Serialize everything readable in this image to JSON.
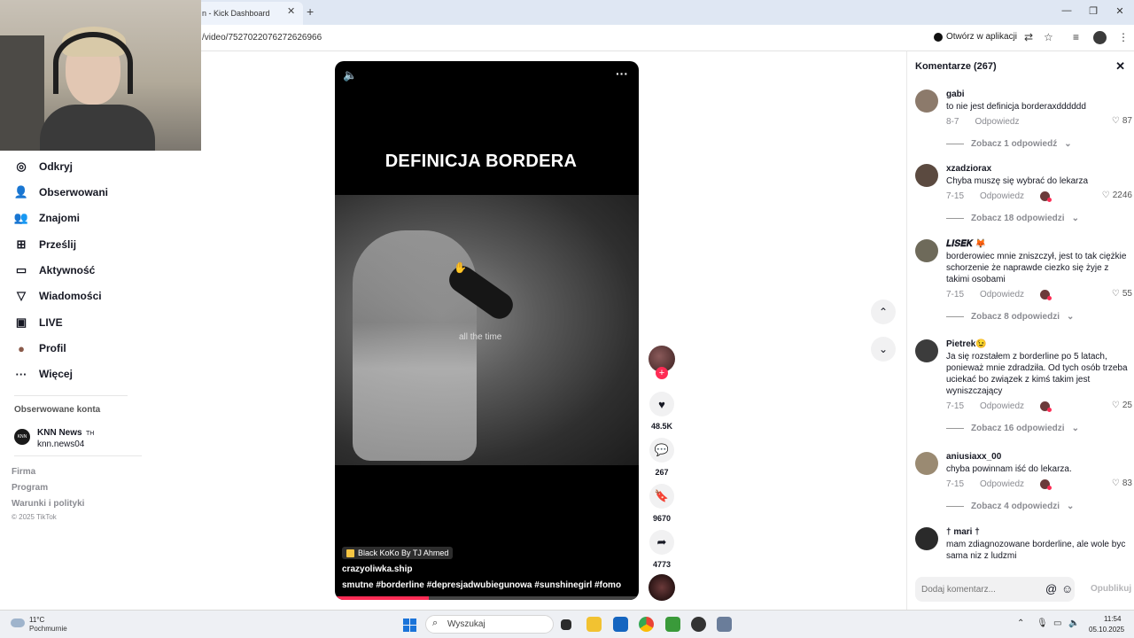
{
  "browser": {
    "tab_title": "n - Kick Dashboard",
    "url": "/video/7527022076272626966",
    "open_in_app": "Otwórz w aplikacji"
  },
  "nav": {
    "items": [
      {
        "label": "Odkryj",
        "icon": "compass-icon"
      },
      {
        "label": "Obserwowani",
        "icon": "user-follow-icon"
      },
      {
        "label": "Znajomi",
        "icon": "friends-icon"
      },
      {
        "label": "Prześlij",
        "icon": "upload-icon"
      },
      {
        "label": "Aktywność",
        "icon": "activity-icon"
      },
      {
        "label": "Wiadomości",
        "icon": "messages-icon"
      },
      {
        "label": "LIVE",
        "icon": "live-icon"
      },
      {
        "label": "Profil",
        "icon": "profile-icon"
      },
      {
        "label": "Więcej",
        "icon": "more-icon"
      }
    ],
    "followed_title": "Obserwowane konta",
    "followed_account": {
      "name": "KNN News",
      "suffix": "TH",
      "handle": "knn.news04",
      "avatar_text": "KNN"
    },
    "footer": [
      "Firma",
      "Program",
      "Warunki i polityki"
    ],
    "copyright": "© 2025 TikTok"
  },
  "video": {
    "overlay_title": "DEFINICJA BORDERA",
    "caption": "all the time",
    "music": "Black KoKo By TJ Ahmed",
    "author": "crazyoliwka.ship",
    "tags": "smutne #borderline  #depresjadwubiegunowa  #sunshinegirl  #fomo",
    "progress": 0.31
  },
  "actions": {
    "likes": "48.5K",
    "comments": "267",
    "saves": "9670",
    "shares": "4773"
  },
  "comments": {
    "header": "Komentarze (267)",
    "input_placeholder": "Dodaj komentarz...",
    "post_label": "Opublikuj",
    "reply_label": "Odpowiedz",
    "items": [
      {
        "user": "gabi",
        "text": "to nie jest definicja borderaxdddddd",
        "date": "8-7",
        "likes": "87",
        "creator_liked": false,
        "view": "Zobacz 1 odpowiedź",
        "avatar": "#8c7a6b"
      },
      {
        "user": "xzadziorax",
        "text": "Chyba muszę się wybrać do lekarza",
        "date": "7-15",
        "likes": "2246",
        "creator_liked": true,
        "view": "Zobacz 18 odpowiedzi",
        "avatar": "#5b4a40"
      },
      {
        "user": "𝑳𝑰𝑺𝑬𝑲 🦊",
        "text": "borderowiec mnie zniszczył, jest to tak ciężkie schorzenie że naprawde ciezko się żyje z takimi osobami",
        "date": "7-15",
        "likes": "55",
        "creator_liked": true,
        "view": "Zobacz 8 odpowiedzi",
        "avatar": "#6e6a5a"
      },
      {
        "user": "Pietrek😉",
        "text": "Ja się rozstałem z borderline po 5 latach, ponieważ mnie zdradziła. Od tych osób trzeba uciekać bo związek z kimś takim jest wyniszczający",
        "date": "7-15",
        "likes": "25",
        "creator_liked": true,
        "view": "Zobacz 16 odpowiedzi",
        "avatar": "#3c3c3c"
      },
      {
        "user": "aniusiaxx_00",
        "text": "chyba powinnam iść do lekarza.",
        "date": "7-15",
        "likes": "83",
        "creator_liked": true,
        "view": "Zobacz 4 odpowiedzi",
        "avatar": "#9a8a72"
      },
      {
        "user": "† mari †",
        "text": "mam zdiagnozowane borderline, ale wole byc sama niz z ludzmi",
        "date": "",
        "likes": "",
        "creator_liked": false,
        "view": "",
        "avatar": "#2a2a2a"
      }
    ]
  },
  "taskbar": {
    "temperature": "11°C",
    "condition": "Pochmurnie",
    "search_placeholder": "Wyszukaj",
    "time": "11:54",
    "date": "05.10.2025"
  },
  "colors": {
    "accent": "#fe2c55",
    "text": "#161823",
    "muted": "#8a8b91"
  }
}
